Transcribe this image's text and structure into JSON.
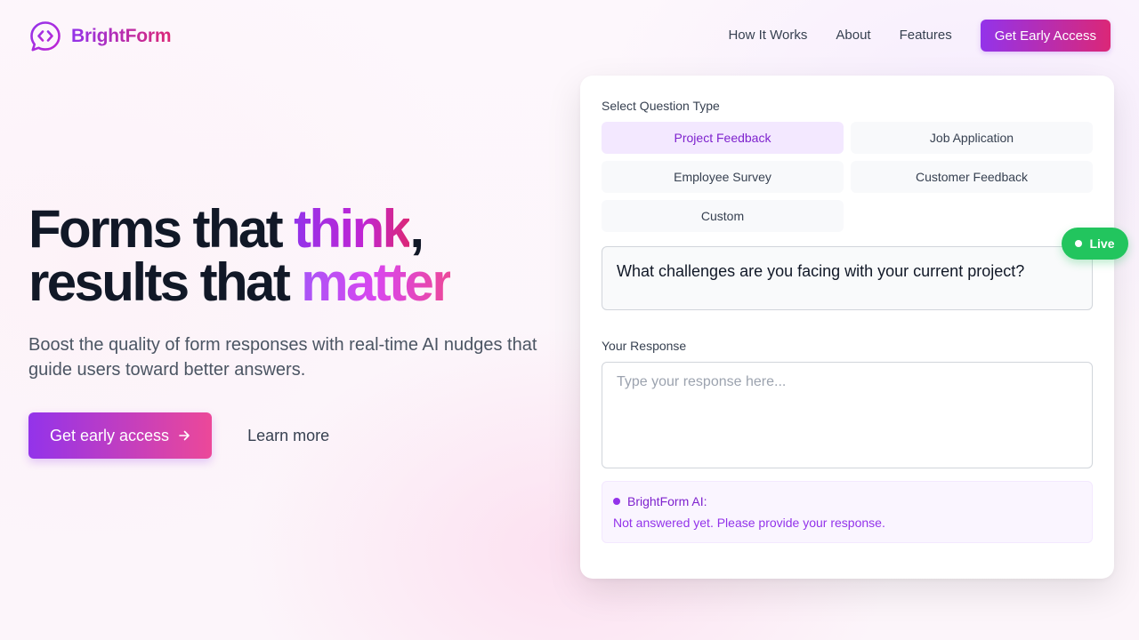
{
  "brand": {
    "name": "BrightForm",
    "icon": "chat-code-icon",
    "accent_start": "#9333ea",
    "accent_end": "#db2777"
  },
  "nav": {
    "links": [
      "How It Works",
      "About",
      "Features"
    ],
    "cta_label": "Get Early Access"
  },
  "hero": {
    "title_part1": "Forms that ",
    "title_highlight1": "think",
    "title_part2": ",",
    "title_part3": "results that ",
    "title_highlight2": "matter",
    "subtitle": "Boost the quality of form responses with real-time AI nudges that guide users toward better answers.",
    "primary_cta": "Get early access",
    "primary_cta_icon": "arrow-right-icon",
    "secondary_cta": "Learn more"
  },
  "card": {
    "question_type_label": "Select Question Type",
    "question_types": [
      "Project Feedback",
      "Job Application",
      "Employee Survey",
      "Customer Feedback",
      "Custom"
    ],
    "selected_type": "Project Feedback",
    "question": "What challenges are you facing with your current project?",
    "response_label": "Your Response",
    "response_value": "",
    "response_placeholder": "Type your response here...",
    "ai_title": "BrightForm AI:",
    "ai_message": "Not answered yet. Please provide your response."
  },
  "live_badge": {
    "label": "Live",
    "color": "#22c55e"
  }
}
